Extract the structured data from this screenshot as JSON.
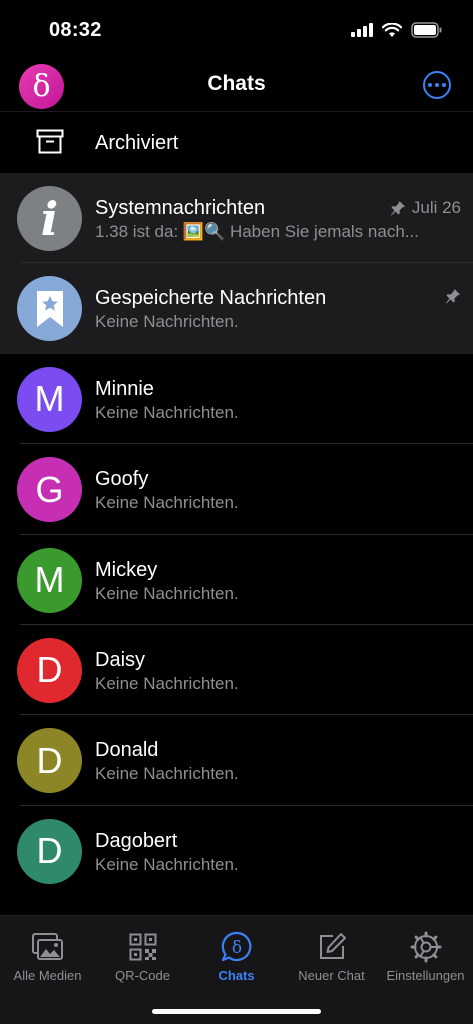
{
  "status_bar": {
    "time": "08:32"
  },
  "nav": {
    "title": "Chats",
    "app_avatar_glyph": "δ"
  },
  "archive": {
    "label": "Archiviert"
  },
  "chats": [
    {
      "name": "Systemnachrichten",
      "preview": "1.38 ist da: 🖼️🔍 Haben Sie jemals nach...",
      "date": "Juli 26",
      "pinned": true,
      "avatar_letter": "i",
      "avatar_color": "#7d8184"
    },
    {
      "name": "Gespeicherte Nachrichten",
      "preview": "Keine Nachrichten.",
      "date": "",
      "pinned": true,
      "avatar_letter": "",
      "avatar_color": "#87a9d8"
    },
    {
      "name": "Minnie",
      "preview": "Keine Nachrichten.",
      "avatar_letter": "M",
      "avatar_color": "#7b4cf0"
    },
    {
      "name": "Goofy",
      "preview": "Keine Nachrichten.",
      "avatar_letter": "G",
      "avatar_color": "#c62fb3"
    },
    {
      "name": "Mickey",
      "preview": "Keine Nachrichten.",
      "avatar_letter": "M",
      "avatar_color": "#3a9a2d"
    },
    {
      "name": "Daisy",
      "preview": "Keine Nachrichten.",
      "avatar_letter": "D",
      "avatar_color": "#e0282f"
    },
    {
      "name": "Donald",
      "preview": "Keine Nachrichten.",
      "avatar_letter": "D",
      "avatar_color": "#8d8626"
    },
    {
      "name": "Dagobert",
      "preview": "Keine Nachrichten.",
      "avatar_letter": "D",
      "avatar_color": "#2f8a6b"
    }
  ],
  "tabs": [
    {
      "label": "Alle Medien",
      "icon": "gallery-icon"
    },
    {
      "label": "QR-Code",
      "icon": "qr-code-icon"
    },
    {
      "label": "Chats",
      "icon": "chats-icon",
      "active": true
    },
    {
      "label": "Neuer Chat",
      "icon": "compose-icon"
    },
    {
      "label": "Einstellungen",
      "icon": "settings-icon"
    }
  ],
  "colors": {
    "accent": "#3b82f6",
    "secondary_text": "#8e8e93",
    "pinned_bg": "#1c1c1e"
  }
}
